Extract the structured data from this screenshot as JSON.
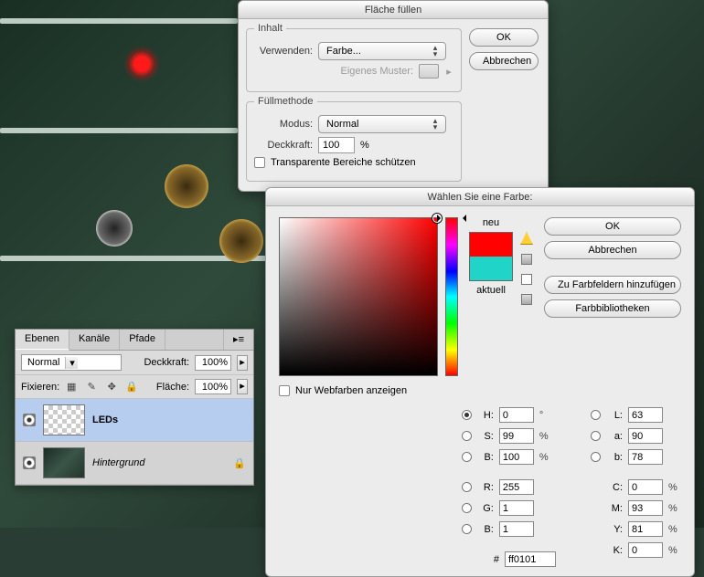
{
  "fill_dialog": {
    "title": "Fläche füllen",
    "group_content": "Inhalt",
    "use_label": "Verwenden:",
    "use_value": "Farbe...",
    "custom_pattern_label": "Eigenes Muster:",
    "group_blend": "Füllmethode",
    "mode_label": "Modus:",
    "mode_value": "Normal",
    "opacity_label": "Deckkraft:",
    "opacity_value": "100",
    "opacity_unit": "%",
    "preserve_label": "Transparente Bereiche schützen",
    "ok": "OK",
    "cancel": "Abbrechen"
  },
  "layers_panel": {
    "tabs": [
      "Ebenen",
      "Kanäle",
      "Pfade"
    ],
    "blend_value": "Normal",
    "opacity_label": "Deckkraft:",
    "opacity_value": "100%",
    "lock_label": "Fixieren:",
    "fill_label": "Fläche:",
    "fill_value": "100%",
    "layers": [
      {
        "name": "LEDs",
        "selected": true,
        "checker": true,
        "locked": false
      },
      {
        "name": "Hintergrund",
        "selected": false,
        "checker": false,
        "locked": true
      }
    ]
  },
  "color_picker": {
    "title": "Wählen Sie eine Farbe:",
    "new_label": "neu",
    "current_label": "aktuell",
    "new_color": "#ff0101",
    "current_color": "#20d5c8",
    "ok": "OK",
    "cancel": "Abbrechen",
    "add_swatch": "Zu Farbfeldern hinzufügen",
    "libraries": "Farbbibliotheken",
    "web_only_label": "Nur Webfarben anzeigen",
    "hex_label": "#",
    "hex_value": "ff0101",
    "hsb": {
      "H": "0",
      "H_u": "°",
      "S": "99",
      "S_u": "%",
      "B": "100",
      "B_u": "%"
    },
    "rgb": {
      "R": "255",
      "G": "1",
      "B": "1"
    },
    "lab": {
      "L": "63",
      "a": "90",
      "b": "78"
    },
    "cmyk": {
      "C": "0",
      "M": "93",
      "Y": "81",
      "K": "0",
      "u": "%"
    }
  }
}
